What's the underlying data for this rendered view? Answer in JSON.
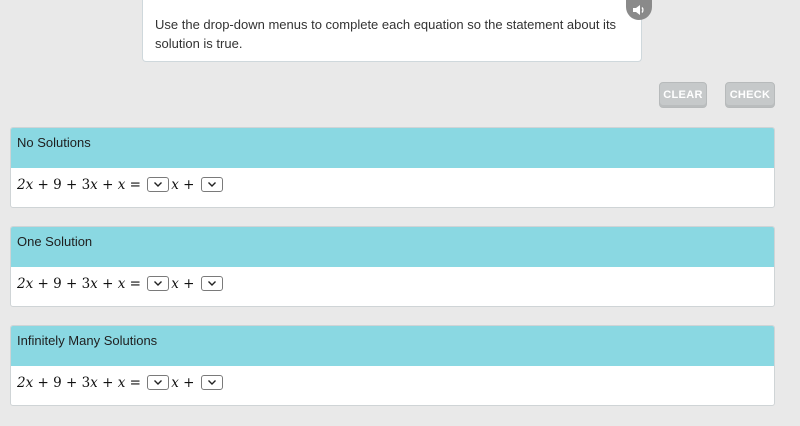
{
  "instructions": "Use the drop-down menus to complete each equation so the statement about its solution is true.",
  "icons": {
    "audio": "speaker-icon",
    "dropdown": "chevron-down-icon"
  },
  "buttons": {
    "clear": "CLEAR",
    "check": "CHECK"
  },
  "colors": {
    "card_header": "#8ad8e2",
    "button": "#c6c9ca"
  },
  "equation": {
    "lhs": "2x + 9 + 3x + x =",
    "rhs_var": "x +"
  },
  "questions": [
    {
      "label": "No Solutions",
      "coefficient": "",
      "constant": ""
    },
    {
      "label": "One Solution",
      "coefficient": "",
      "constant": ""
    },
    {
      "label": "Infinitely Many Solutions",
      "coefficient": "",
      "constant": ""
    }
  ]
}
